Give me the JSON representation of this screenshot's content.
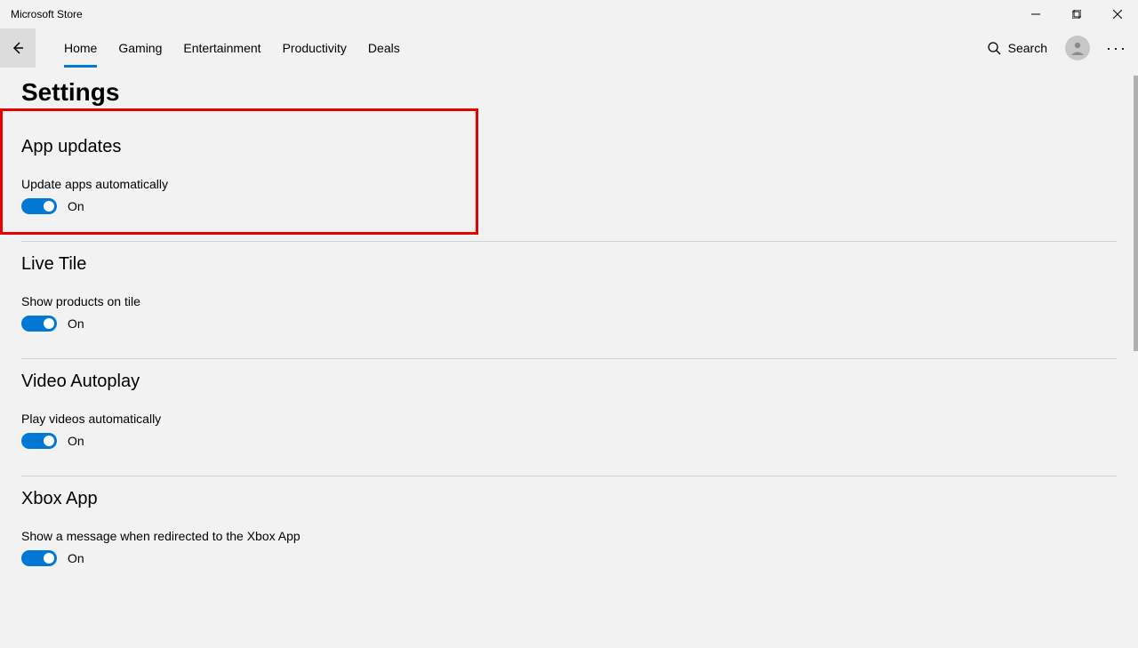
{
  "window": {
    "title": "Microsoft Store"
  },
  "nav": {
    "tabs": [
      {
        "label": "Home",
        "active": true
      },
      {
        "label": "Gaming",
        "active": false
      },
      {
        "label": "Entertainment",
        "active": false
      },
      {
        "label": "Productivity",
        "active": false
      },
      {
        "label": "Deals",
        "active": false
      }
    ],
    "search_label": "Search"
  },
  "page": {
    "title": "Settings",
    "sections": [
      {
        "id": "app-updates",
        "heading": "App updates",
        "setting": "Update apps automatically",
        "toggle": {
          "on": true,
          "state_label": "On"
        },
        "highlighted": true
      },
      {
        "id": "live-tile",
        "heading": "Live Tile",
        "setting": "Show products on tile",
        "toggle": {
          "on": true,
          "state_label": "On"
        }
      },
      {
        "id": "video-autoplay",
        "heading": "Video Autoplay",
        "setting": "Play videos automatically",
        "toggle": {
          "on": true,
          "state_label": "On"
        }
      },
      {
        "id": "xbox-app",
        "heading": "Xbox App",
        "setting": "Show a message when redirected to the Xbox App",
        "toggle": {
          "on": true,
          "state_label": "On"
        }
      }
    ]
  }
}
